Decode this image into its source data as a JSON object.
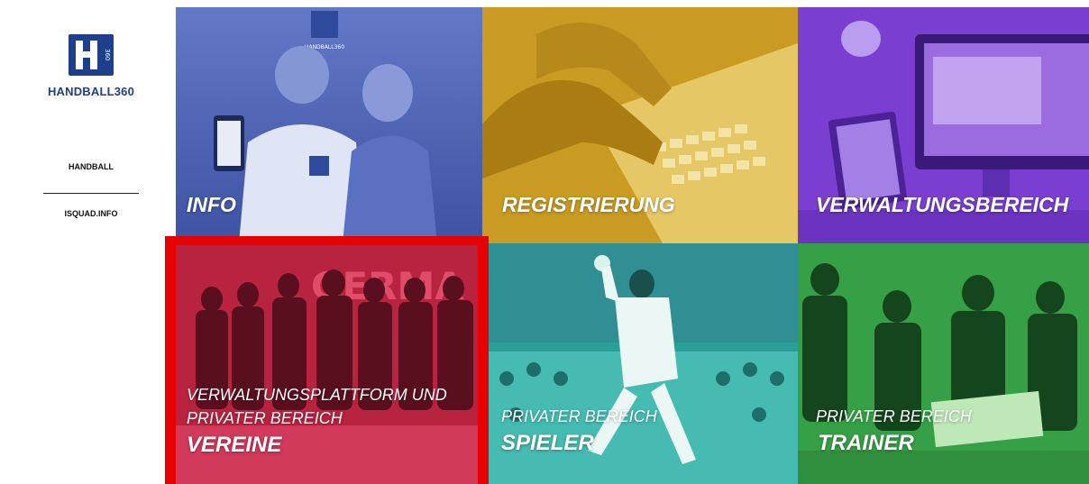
{
  "sidebar": {
    "logo_text": "HANDBALL360",
    "items": [
      {
        "label": "HANDBALL"
      },
      {
        "label": "ISQUAD.INFO"
      }
    ]
  },
  "tiles": [
    {
      "id": "info",
      "label": "INFO",
      "color": "#4b63b5"
    },
    {
      "id": "registrierung",
      "label": "REGISTRIERUNG",
      "color": "#d0a429"
    },
    {
      "id": "verwaltungsbereich",
      "label": "VERWALTUNGSBEREICH",
      "color": "#7a3fd0"
    },
    {
      "id": "vereine",
      "sub_lines": [
        "VERWALTUNGSPLATTFORM UND",
        "PRIVATER BEREICH"
      ],
      "label": "VEREINE",
      "color": "#c0264a",
      "selected": true,
      "highlight": "#e60000"
    },
    {
      "id": "spieler",
      "sub_lines": [
        "PRIVATER BEREICH"
      ],
      "label": "SPIELER",
      "color": "#2ea8a0"
    },
    {
      "id": "trainer",
      "sub_lines": [
        "PRIVATER BEREICH"
      ],
      "label": "TRAINER",
      "color": "#3aa84a"
    }
  ]
}
